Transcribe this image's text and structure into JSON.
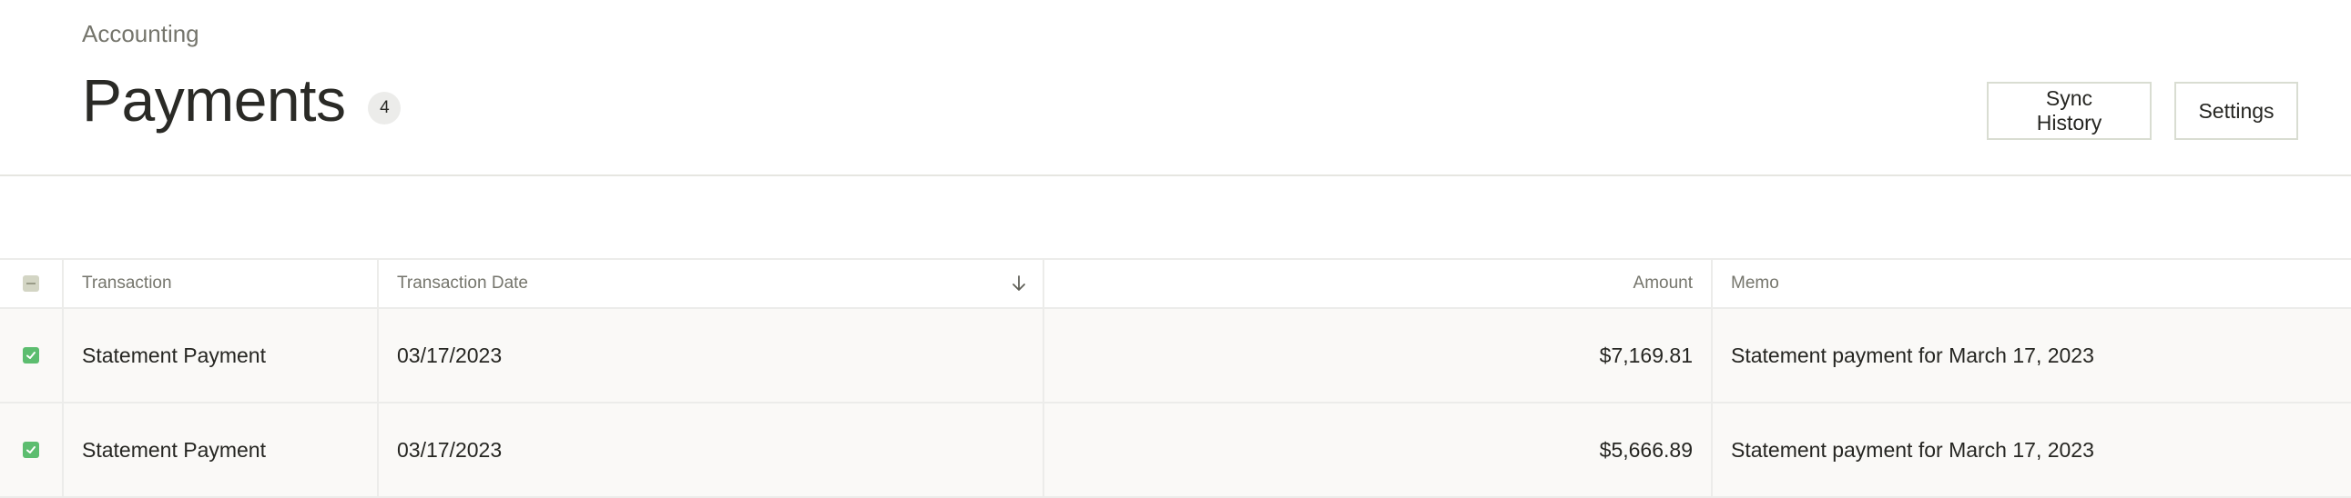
{
  "header": {
    "breadcrumb": "Accounting",
    "title": "Payments",
    "count": "4",
    "sync_history_label": "Sync History",
    "settings_label": "Settings"
  },
  "table": {
    "columns": {
      "transaction": "Transaction",
      "transaction_date": "Transaction Date",
      "amount": "Amount",
      "memo": "Memo"
    },
    "sort": {
      "column": "transaction_date",
      "direction": "descending",
      "icon": "arrow-down-icon"
    },
    "header_checkbox_state": "indeterminate",
    "rows": [
      {
        "checked": true,
        "transaction": "Statement Payment",
        "date": "03/17/2023",
        "amount": "$7,169.81",
        "memo": "Statement payment for March 17, 2023"
      },
      {
        "checked": true,
        "transaction": "Statement Payment",
        "date": "03/17/2023",
        "amount": "$5,666.89",
        "memo": "Statement payment for March 17, 2023"
      }
    ]
  },
  "colors": {
    "checkbox_checked": "#5cbd6f",
    "checkbox_indeterminate": "#d3d5c4",
    "row_background": "#faf9f7"
  }
}
